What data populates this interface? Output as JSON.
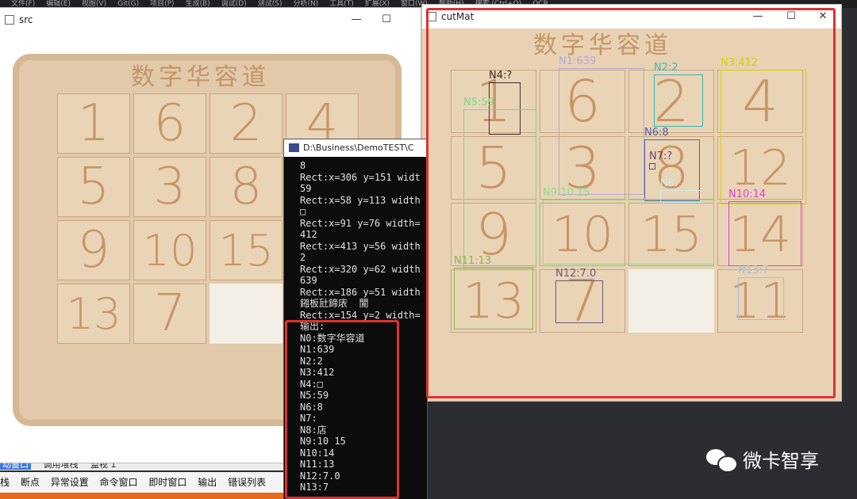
{
  "ide": {
    "menu": [
      "文件(F)",
      "编辑(E)",
      "视图(V)",
      "Git(G)",
      "项目(P)",
      "生成(B)",
      "调试(D)",
      "测试(S)",
      "分析(N)",
      "工具(T)",
      "扩展(X)",
      "窗口(W)",
      "帮助(H)",
      "搜索 (Ctrl+Q)",
      "OCR"
    ],
    "bottom_tabs": [
      "动窗口",
      "调用堆栈",
      "监视 1"
    ],
    "toolbar": [
      "断点",
      "异常设置",
      "命令窗口",
      "即时窗口",
      "输出",
      "错误列表"
    ],
    "toolbar_lead": "堆栈"
  },
  "src_window": {
    "title": "src"
  },
  "puzzle": {
    "title": "数字华容道",
    "tiles": [
      "1",
      "6",
      "2",
      "4",
      "5",
      "3",
      "8",
      "12",
      "9",
      "10",
      "15",
      "14",
      "13",
      "7",
      "",
      "11"
    ]
  },
  "console": {
    "title": "D:\\Business\\DemoTEST\\C",
    "lines": [
      "8",
      "Rect:x=306 y=151 widt",
      "59",
      "Rect:x=58 y=113 width",
      "□",
      "Rect:x=91 y=76 width=",
      "412",
      "Rect:x=413 y=56 width",
      "2",
      "Rect:x=320 y=62 width",
      "639",
      "Rect:x=186 y=51 width",
      "鎺板瓧鍗庡  閬",
      "Rect:x=154 y=2 width=",
      "输出:",
      "N0:数字华容道",
      "N1:639",
      "N2:2",
      "N3:412",
      "N4:□",
      "N5:59",
      "N6:8",
      "N7:",
      "N8:店",
      "N9:10 15",
      "N10:14",
      "N11:13",
      "N12:7.0",
      "N13:7"
    ]
  },
  "cutmat_window": {
    "title": "cutMat",
    "detections": [
      {
        "label": "N4:?",
        "color": "#3a2a2a"
      },
      {
        "label": "N1:639",
        "color": "#b9a4d6"
      },
      {
        "label": "N2:2",
        "color": "#38b6b0"
      },
      {
        "label": "N3:412",
        "color": "#d8d000"
      },
      {
        "label": "N5:59",
        "color": "#7dd78a"
      },
      {
        "label": "N6:8",
        "color": "#5860a8"
      },
      {
        "label": "N7:?",
        "color": "#7a3d7a"
      },
      {
        "label": "N8:",
        "color": "#d5e8f0"
      },
      {
        "label": "N9:10 15",
        "color": "#8edc8e"
      },
      {
        "label": "N10:14",
        "color": "#e040d8"
      },
      {
        "label": "N11:13",
        "color": "#8ab84a"
      },
      {
        "label": "N12:7.0",
        "color": "#6a5a7a"
      },
      {
        "label": "N13:7",
        "color": "#a8c0d8"
      }
    ]
  },
  "watermark": {
    "text": "微卡智享"
  }
}
